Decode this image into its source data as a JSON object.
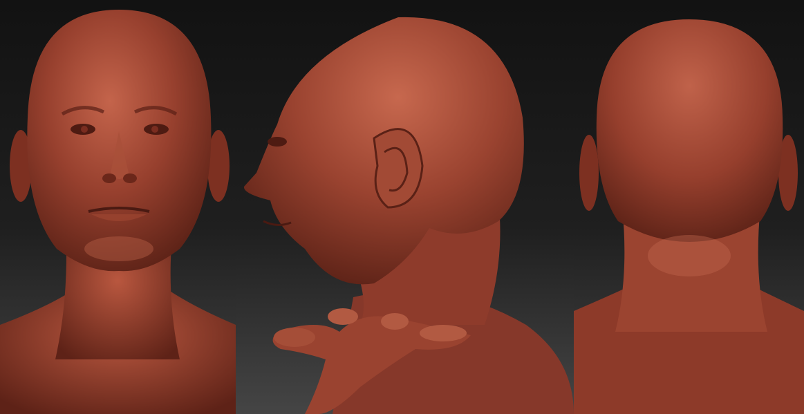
{
  "views": [
    {
      "id": "front",
      "icon": "head-front-view"
    },
    {
      "id": "side",
      "icon": "head-side-view"
    },
    {
      "id": "back",
      "icon": "head-back-view"
    }
  ],
  "colors": {
    "background_top": "#141414",
    "background_bottom": "#3a3a3a",
    "clay_base": "#8e3b2a",
    "clay_light": "#c0624a",
    "clay_dark": "#4a1a12"
  }
}
